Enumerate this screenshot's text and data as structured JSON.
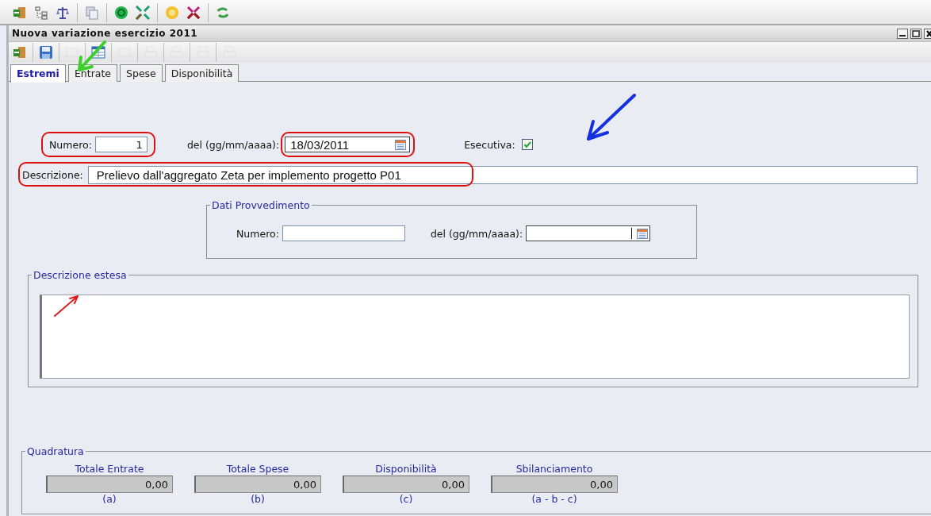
{
  "window": {
    "title": "Nuova variazione esercizio 2011"
  },
  "toolbar": [
    {
      "disabled": false
    },
    {
      "disabled": false
    },
    {
      "disabled": true
    },
    {
      "disabled": false
    },
    {
      "disabled": true
    },
    {
      "disabled": true
    },
    {
      "disabled": true
    },
    {
      "disabled": true
    },
    {
      "disabled": true
    }
  ],
  "tabs": [
    {
      "label": "Estremi",
      "selected": true
    },
    {
      "label": "Entrate",
      "selected": false
    },
    {
      "label": "Spese",
      "selected": false
    },
    {
      "label": "Disponibilità",
      "selected": false
    }
  ],
  "form": {
    "numero": {
      "label": "Numero:",
      "value": "1"
    },
    "data": {
      "label": "del (gg/mm/aaaa):",
      "value": "18/03/2011"
    },
    "esecutiva": {
      "label": "Esecutiva:",
      "checked": true
    },
    "descrizione": {
      "label": "Descrizione:",
      "value": "Prelievo dall'aggregato Zeta per implemento progetto P01"
    }
  },
  "provvedimento": {
    "legend": "Dati Provvedimento",
    "numero": {
      "label": "Numero:"
    },
    "data": {
      "label": "del (gg/mm/aaaa):"
    }
  },
  "descrizione_estesa": {
    "legend": "Descrizione estesa"
  },
  "quadratura": {
    "legend": "Quadratura",
    "totals": [
      {
        "label": "Totale Entrate",
        "value": "0,00",
        "note": "(a)"
      },
      {
        "label": "Totale Spese",
        "value": "0,00",
        "note": "(b)"
      },
      {
        "label": "Disponibilità",
        "value": "0,00",
        "note": "(c)"
      },
      {
        "label": "Sbilanciamento",
        "value": "0,00",
        "note": "(a - b - c)"
      }
    ]
  },
  "annotations": {
    "arrows": [
      {
        "color": "#3ccf2a"
      },
      {
        "color": "#1530e0"
      },
      {
        "color": "#e02020"
      }
    ],
    "outlines": [
      {
        "color": "#dd1111"
      },
      {
        "color": "#dd1111"
      },
      {
        "color": "#dd1111"
      }
    ]
  }
}
